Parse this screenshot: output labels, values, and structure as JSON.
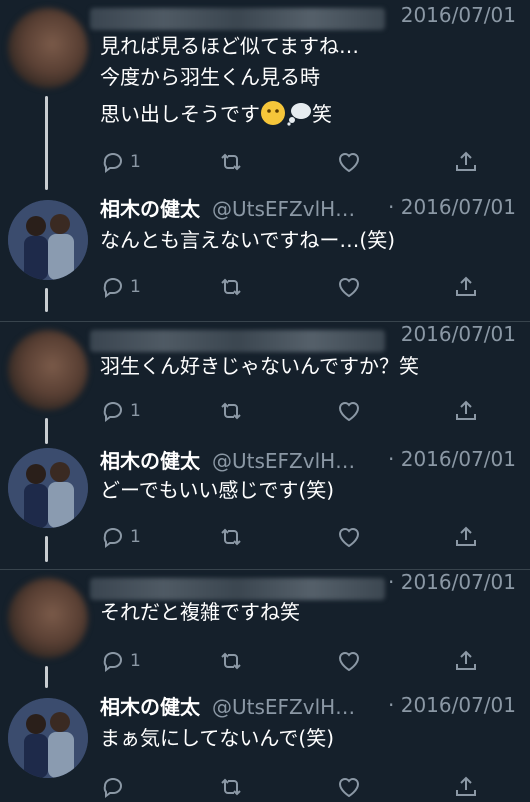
{
  "tweets": [
    {
      "author": "hidden",
      "date": "2016/07/01",
      "lines": [
        "見れば見るほど似てますね…",
        "今度から羽生くん見る時",
        "思い出しそうです"
      ],
      "suffix": "笑",
      "reply_count": "1"
    },
    {
      "author": "kenta",
      "name": "相木の健太",
      "handle": "@UtsEFZvlH…",
      "date": "· 2016/07/01",
      "lines": [
        "なんとも言えないですねー…(笑)"
      ],
      "reply_count": "1"
    },
    {
      "author": "hidden",
      "date": "2016/07/01",
      "lines": [
        "羽生くん好きじゃないんですか？笑"
      ],
      "reply_count": "1"
    },
    {
      "author": "kenta",
      "name": "相木の健太",
      "handle": "@UtsEFZvlH…",
      "date": "· 2016/07/01",
      "lines": [
        "どーでもいい感じです(笑)"
      ],
      "reply_count": "1"
    },
    {
      "author": "hidden",
      "date": "· 2016/07/01",
      "lines": [
        "それだと複雑ですね笑"
      ],
      "reply_count": "1"
    },
    {
      "author": "kenta",
      "name": "相木の健太",
      "handle": "@UtsEFZvlH…",
      "date": "· 2016/07/01",
      "lines": [
        "まぁ気にしてないんで(笑)"
      ],
      "reply_count": ""
    }
  ],
  "icons": {
    "reply": "reply-icon",
    "retweet": "retweet-icon",
    "like": "heart-icon",
    "share": "share-icon"
  },
  "colors": {
    "background": "#15202b",
    "muted": "#8b98a5",
    "divider": "#38444d",
    "thread_line": "#c9cdd1"
  }
}
